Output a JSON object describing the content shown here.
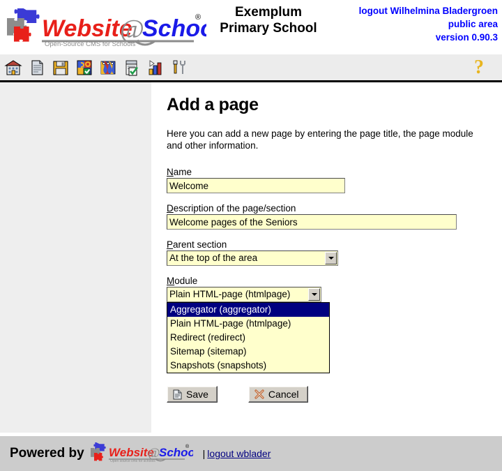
{
  "header": {
    "logo": {
      "name": "Website@School",
      "word_website": "Website",
      "word_at": "@",
      "word_school": "School",
      "registered_mark": "®",
      "tagline": "Open-Source CMS for Schools"
    },
    "school_title_line1": "Exemplum",
    "school_title_line2": "Primary School",
    "user": {
      "logout_label": "logout",
      "user_name": "Wilhelmina Bladergroen",
      "area": "public area",
      "version": "version 0.90.3"
    }
  },
  "toolbar": {
    "icons": [
      {
        "name": "home-icon",
        "title": "Home"
      },
      {
        "name": "page-icon",
        "title": "Page"
      },
      {
        "name": "floppy-save-icon",
        "title": "File manager"
      },
      {
        "name": "modules-puzzle-icon",
        "title": "Modules"
      },
      {
        "name": "users-icon",
        "title": "Users"
      },
      {
        "name": "checklist-icon",
        "title": "Account"
      },
      {
        "name": "statistics-chart-icon",
        "title": "Statistics"
      },
      {
        "name": "tools-icon",
        "title": "Tools"
      }
    ],
    "help_glyph": "?",
    "help_name": "help-icon"
  },
  "main": {
    "page_title": "Add a page",
    "intro": "Here you can add a new page by entering the page title, the page module and other information.",
    "fields": {
      "name": {
        "label_accesskey": "N",
        "label_rest": "ame",
        "label_full": "Name",
        "value": "Welcome",
        "placeholder": ""
      },
      "description": {
        "label_accesskey": "D",
        "label_rest": "escription of the page/section",
        "label_full": "Description of the page/section",
        "value": "Welcome pages of the Seniors",
        "placeholder": ""
      },
      "parent_section": {
        "label_accesskey": "P",
        "label_rest": "arent section",
        "label_full": "Parent section",
        "value": "At the top of the area",
        "options": [
          "At the top of the area"
        ]
      },
      "module": {
        "label_accesskey": "M",
        "label_rest": "odule",
        "label_full": "Module",
        "value": "Plain HTML-page (htmlpage)",
        "expanded": true,
        "highlighted_index": 0,
        "options": [
          "Aggregator (aggregator)",
          "Plain HTML-page (htmlpage)",
          "Redirect (redirect)",
          "Sitemap (sitemap)",
          "Snapshots (snapshots)"
        ]
      }
    },
    "buttons": {
      "save": "Save",
      "cancel": "Cancel"
    }
  },
  "footer": {
    "powered_by": "Powered by",
    "logo_website": "Website",
    "logo_at": "@",
    "logo_school": "School",
    "logo_mark": "®",
    "logo_tagline": "Open source cms for schools",
    "separator": "|",
    "logout_link": "logout wblader"
  },
  "colors": {
    "accent_blue": "#0000ff",
    "highlight_navy": "#000080",
    "field_yellow": "#ffffcc",
    "sidebar_gray": "#eeeeee",
    "toolbar_gray": "#ececec",
    "footer_gray": "#cccccc",
    "logo_red": "#e8201a",
    "logo_blue": "#1a1ae8",
    "help_yellow": "#e8b520"
  }
}
